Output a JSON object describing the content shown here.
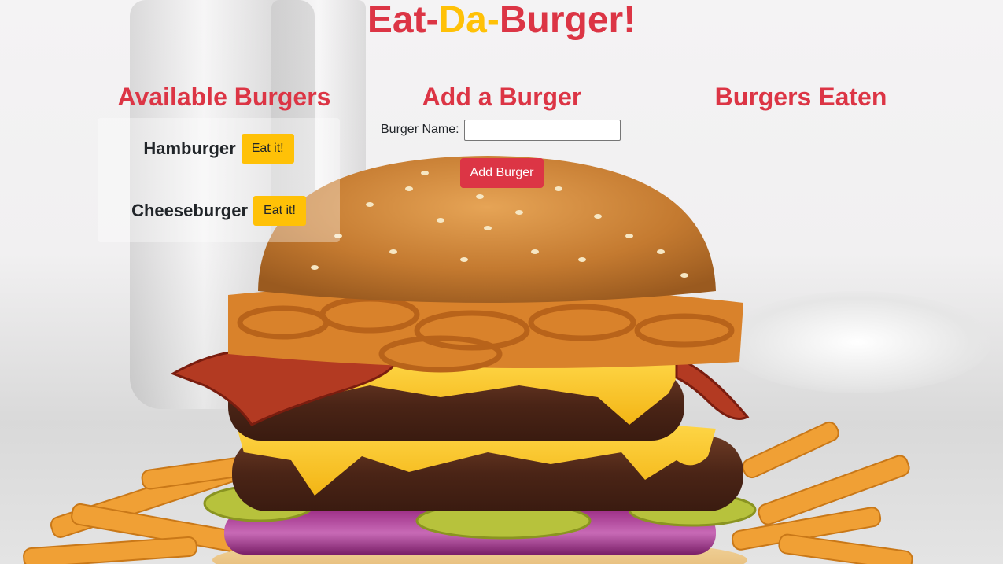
{
  "header": {
    "title_part1": "Eat-",
    "title_part2": "Da-",
    "title_part3": "Burger!"
  },
  "available": {
    "heading": "Available Burgers",
    "items": [
      {
        "name": "Hamburger",
        "button_label": "Eat it!"
      },
      {
        "name": "Cheeseburger",
        "button_label": "Eat it!"
      }
    ]
  },
  "add_form": {
    "heading": "Add a Burger",
    "label": "Burger Name:",
    "input_value": "",
    "submit_label": "Add Burger"
  },
  "eaten": {
    "heading": "Burgers Eaten"
  },
  "colors": {
    "accent_red": "#dc3545",
    "accent_yellow": "#ffc107"
  }
}
